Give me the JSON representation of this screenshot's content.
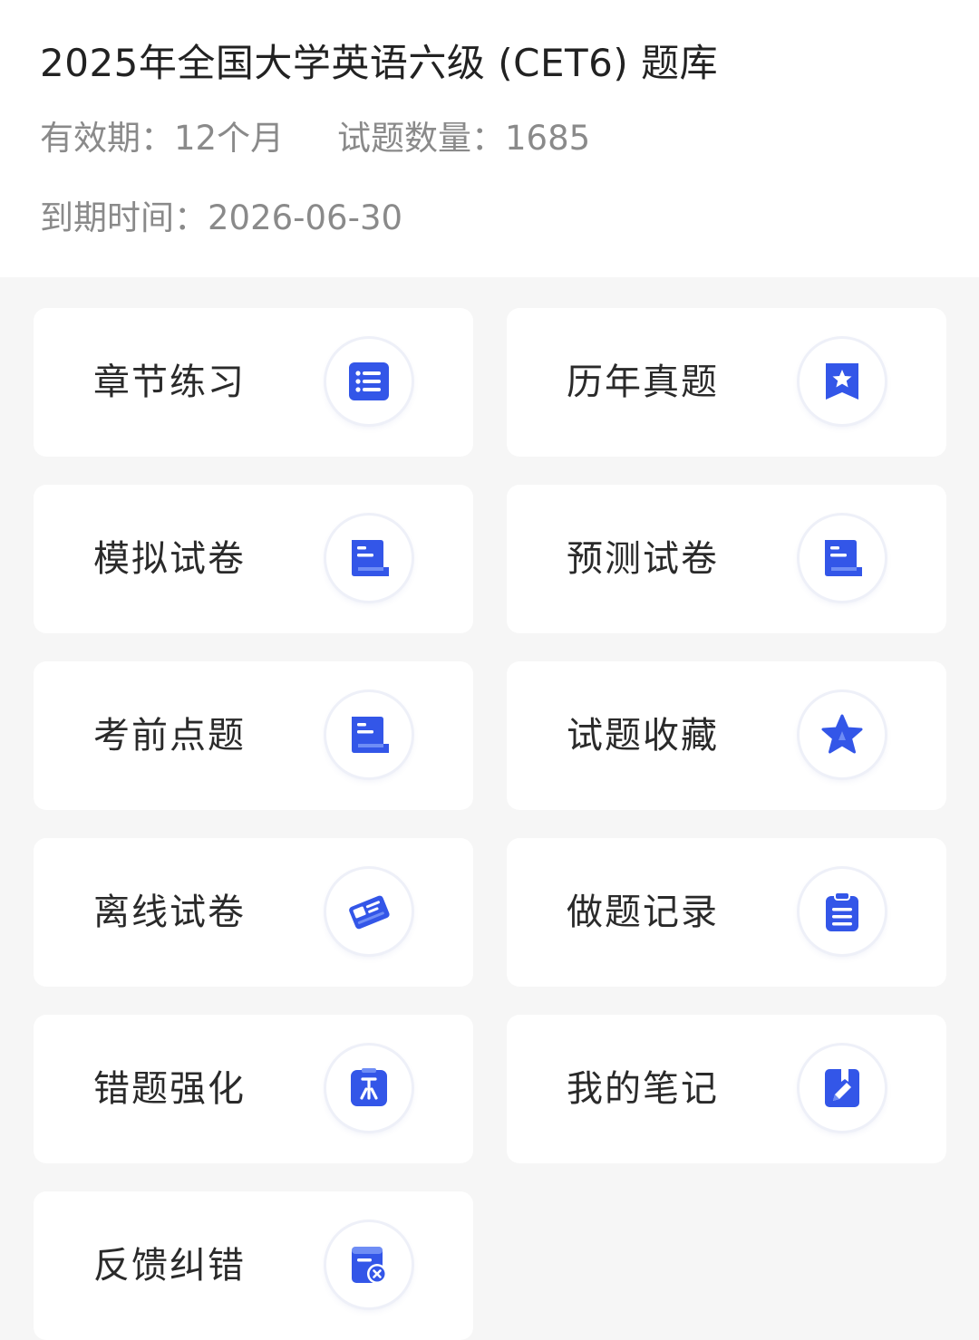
{
  "header": {
    "title": "2025年全国大学英语六级 (CET6) 题库",
    "validity_label": "有效期：",
    "validity_value": "12个月",
    "count_label": "试题数量：",
    "count_value": "1685",
    "expiry_label": "到期时间：",
    "expiry_value": "2026-06-30"
  },
  "menu": {
    "items": [
      {
        "label": "章节练习",
        "icon": "list-icon"
      },
      {
        "label": "历年真题",
        "icon": "bookmark-star-icon"
      },
      {
        "label": "模拟试卷",
        "icon": "document-icon"
      },
      {
        "label": "预测试卷",
        "icon": "document-icon"
      },
      {
        "label": "考前点题",
        "icon": "document-icon"
      },
      {
        "label": "试题收藏",
        "icon": "star-icon"
      },
      {
        "label": "离线试卷",
        "icon": "download-paper-icon"
      },
      {
        "label": "做题记录",
        "icon": "clipboard-icon"
      },
      {
        "label": "错题强化",
        "icon": "pin-icon"
      },
      {
        "label": "我的笔记",
        "icon": "note-pen-icon"
      },
      {
        "label": "反馈纠错",
        "icon": "feedback-error-icon"
      }
    ]
  },
  "colors": {
    "accent": "#3356e8",
    "accent_light": "#6f8df5"
  }
}
